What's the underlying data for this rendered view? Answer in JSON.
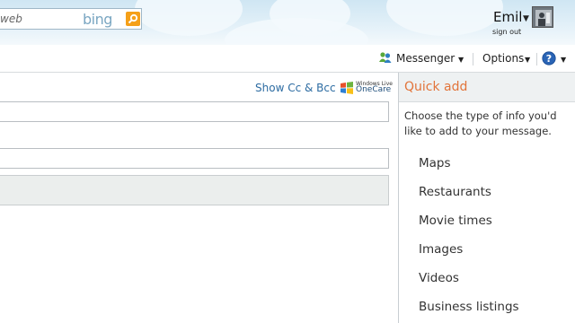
{
  "header": {
    "search_value": "web",
    "search_brand": "bing",
    "user_name": "Emil",
    "sign_out": "sign out"
  },
  "toolbar": {
    "messenger": "Messenger",
    "options": "Options"
  },
  "compose": {
    "show_cc_bcc": "Show Cc & Bcc",
    "onecare_line1": "Windows Live",
    "onecare_line2": "OneCare"
  },
  "quick_add": {
    "title": "Quick add",
    "description": "Choose the type of info you'd like to add to your message.",
    "items": [
      "Maps",
      "Restaurants",
      "Movie times",
      "Images",
      "Videos",
      "Business listings"
    ]
  },
  "colors": {
    "accent_orange": "#e2743a",
    "link_blue": "#2d6ca2",
    "search_button": "#f5a019"
  }
}
